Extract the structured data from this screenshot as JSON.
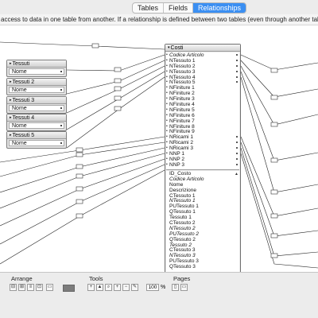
{
  "tabs": [
    {
      "label": "Tables",
      "active": false
    },
    {
      "label": "Fields",
      "active": false
    },
    {
      "label": "Relationships",
      "active": true
    }
  ],
  "info_text": "access to data in one table from another. If a relationship is defined between two tables (even through another table), fields from o",
  "tessuti_tables": [
    {
      "title": "Tessuti",
      "field": "Nome"
    },
    {
      "title": "Tessuti 2",
      "field": "Nome"
    },
    {
      "title": "Tessuti 3",
      "field": "Nome"
    },
    {
      "title": "Tessuti 4",
      "field": "Nome"
    },
    {
      "title": "Tessuti 5",
      "field": "Nome"
    }
  ],
  "costi_table": {
    "title": "Costi",
    "key_fields": [
      {
        "name": "Codice Articolo",
        "italic": true,
        "rel": true
      },
      {
        "name": "NTessuto 1",
        "rel": true
      },
      {
        "name": "NTessuto 2",
        "rel": true
      },
      {
        "name": "NTessuto 3",
        "rel": true
      },
      {
        "name": "NTessuto 4",
        "rel": true
      },
      {
        "name": "NTessuto 5",
        "rel": true
      },
      {
        "name": "NFiniture 1",
        "rel": false
      },
      {
        "name": "NFiniture 2",
        "rel": false
      },
      {
        "name": "NFiniture 3",
        "rel": false
      },
      {
        "name": "NFiniture 4",
        "rel": false
      },
      {
        "name": "NFiniture 5",
        "rel": false
      },
      {
        "name": "NFiniture 6",
        "rel": false
      },
      {
        "name": "NFiniture 7",
        "rel": false
      },
      {
        "name": "NFiniture 8",
        "rel": false
      },
      {
        "name": "NFiniture 9",
        "rel": false
      },
      {
        "name": "NRicami 1",
        "rel": true
      },
      {
        "name": "NRicami 2",
        "rel": true
      },
      {
        "name": "NRicami 3",
        "rel": true
      },
      {
        "name": "NNP 1",
        "rel": true
      },
      {
        "name": "NNP 2",
        "rel": true
      },
      {
        "name": "NNP 3",
        "rel": true
      }
    ],
    "other_fields": [
      {
        "name": "ID_Costo",
        "italic": false
      },
      {
        "name": "Codice Articolo",
        "italic": true
      },
      {
        "name": "Nome",
        "italic": false
      },
      {
        "name": "Descrizione",
        "italic": false
      },
      {
        "name": "CTessuto 1",
        "italic": false
      },
      {
        "name": "NTessuto 1",
        "italic": true
      },
      {
        "name": "PUTessuto 1",
        "italic": false
      },
      {
        "name": "QTessuto 1",
        "italic": false
      },
      {
        "name": "Tessuto 1",
        "italic": false
      },
      {
        "name": "CTessuto 2",
        "italic": false
      },
      {
        "name": "NTessuto 2",
        "italic": true
      },
      {
        "name": "PUTessuto 2",
        "italic": true
      },
      {
        "name": "QTessuto 2",
        "italic": false
      },
      {
        "name": "Tessuto 2",
        "italic": true
      },
      {
        "name": "CTessuto 3",
        "italic": false
      },
      {
        "name": "NTessuto 3",
        "italic": true
      },
      {
        "name": "PUTessuto 3",
        "italic": false
      },
      {
        "name": "QTessuto 3",
        "italic": false
      }
    ]
  },
  "bottom_bar": {
    "arrange_label": "Arrange",
    "tools_label": "Tools",
    "pages_label": "Pages",
    "zoom_value": "100",
    "zoom_unit": "%"
  },
  "colors": {
    "active_tab": "#3b8ff2",
    "line": "#222222"
  }
}
